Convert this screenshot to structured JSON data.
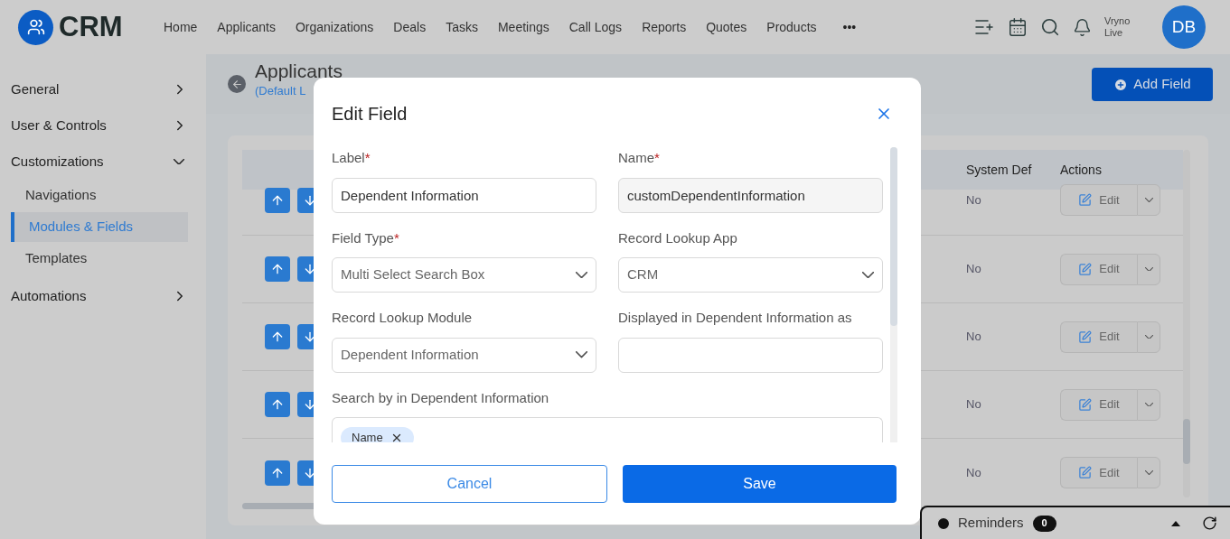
{
  "nav": {
    "logo": "CRM",
    "items": [
      {
        "label": "Home"
      },
      {
        "label": "Applicants"
      },
      {
        "label": "Organizations"
      },
      {
        "label": "Deals"
      },
      {
        "label": "Tasks"
      },
      {
        "label": "Meetings"
      },
      {
        "label": "Call Logs"
      },
      {
        "label": "Reports"
      },
      {
        "label": "Quotes"
      },
      {
        "label": "Products"
      }
    ],
    "more": "•••",
    "instance": "Vryno Live",
    "avatar": "DB"
  },
  "sidebar": {
    "items": [
      {
        "label": "General",
        "expanded": false
      },
      {
        "label": "User & Controls",
        "expanded": false
      },
      {
        "label": "Customizations",
        "expanded": true,
        "children": [
          {
            "label": "Navigations",
            "selected": false
          },
          {
            "label": "Modules & Fields",
            "selected": true
          },
          {
            "label": "Templates",
            "selected": false
          }
        ]
      },
      {
        "label": "Automations",
        "expanded": false
      }
    ]
  },
  "page": {
    "title": "Applicants",
    "subtitle": "(Default L",
    "add_button": "Add Field"
  },
  "table": {
    "columns": [
      "System Def",
      "Actions"
    ],
    "rows": [
      {
        "system_def": "No",
        "action": "Edit"
      },
      {
        "system_def": "No",
        "action": "Edit"
      },
      {
        "system_def": "No",
        "action": "Edit"
      },
      {
        "system_def": "No",
        "action": "Edit"
      },
      {
        "system_def": "No",
        "action": "Edit"
      }
    ]
  },
  "modal": {
    "title": "Edit Field",
    "fields": [
      {
        "kind": "text",
        "label": "Label",
        "required_mark": "*",
        "value": "Dependent Information"
      },
      {
        "kind": "readonly",
        "label": "Name",
        "required_mark": "*",
        "value": "customDependentInformation"
      },
      {
        "kind": "select",
        "label": "Field Type",
        "required_mark": "*",
        "value": "Multi Select Search Box"
      },
      {
        "kind": "select",
        "label": "Record Lookup App",
        "value": "CRM"
      },
      {
        "kind": "select",
        "label": "Record Lookup Module",
        "value": "Dependent Information"
      },
      {
        "kind": "text",
        "label": "Displayed in Dependent Information as"
      },
      {
        "kind": "tags",
        "label": "Search by in Dependent Information",
        "tags": [
          "Name"
        ]
      }
    ],
    "cancel": "Cancel",
    "save": "Save"
  },
  "reminders": {
    "label": "Reminders",
    "count": "0"
  }
}
